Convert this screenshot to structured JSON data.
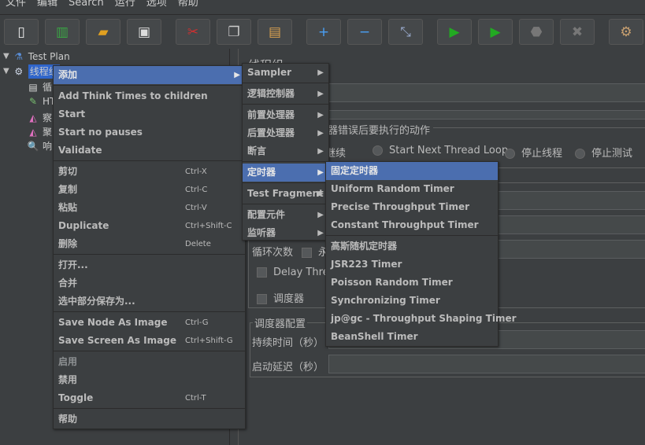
{
  "menubar": [
    "文件",
    "编辑",
    "Search",
    "运行",
    "选项",
    "帮助"
  ],
  "toolbar": [
    {
      "icon": "new-icon",
      "g": "▯",
      "c": "#eeeeee"
    },
    {
      "icon": "templates-icon",
      "g": "▥",
      "c": "#3aa844"
    },
    {
      "icon": "open-icon",
      "g": "▰",
      "c": "#e0a020"
    },
    {
      "icon": "save-icon",
      "g": "▣",
      "c": "#dddddd"
    },
    {
      "icon": "cut-icon",
      "g": "✂",
      "c": "#d03030"
    },
    {
      "icon": "copy-icon",
      "g": "❐",
      "c": "#cccccc"
    },
    {
      "icon": "paste-icon",
      "g": "▤",
      "c": "#d8a050"
    },
    {
      "icon": "expand-icon",
      "g": "+",
      "c": "#4a9ff5"
    },
    {
      "icon": "collapse-icon",
      "g": "−",
      "c": "#4a9ff5"
    },
    {
      "icon": "toggle-icon",
      "g": "⤡",
      "c": "#9ac"
    },
    {
      "icon": "start-icon",
      "g": "▶",
      "c": "#22aa22"
    },
    {
      "icon": "start-no-pauses-icon",
      "g": "▶",
      "c": "#22aa22"
    },
    {
      "icon": "stop-icon",
      "g": "⬣",
      "c": "#777"
    },
    {
      "icon": "shutdown-icon",
      "g": "✖",
      "c": "#777"
    },
    {
      "icon": "clear-icon",
      "g": "⚙",
      "c": "#c8a070"
    }
  ],
  "tree": {
    "items": [
      {
        "label": "Test Plan",
        "icon": "flask-icon",
        "g": "⚗",
        "c": "#5a8fd8"
      },
      {
        "label": "线程组",
        "icon": "gear-icon",
        "g": "⚙",
        "c": "#cfd8e8"
      },
      {
        "label": "循",
        "icon": "controller-icon",
        "g": "▤",
        "c": "#dddddd"
      },
      {
        "label": "HT",
        "icon": "pipette-icon",
        "g": "✎",
        "c": "#7ac070"
      },
      {
        "label": "察",
        "icon": "listener-icon",
        "g": "◭",
        "c": "#e070c0"
      },
      {
        "label": "聚",
        "icon": "listener-icon",
        "g": "◭",
        "c": "#e070c0"
      },
      {
        "label": "响",
        "icon": "magnifier-icon",
        "g": "🔍",
        "c": "#dddddd"
      }
    ]
  },
  "right": {
    "title": "线程组",
    "error_group": "在取样器错误后要执行的动作",
    "radios": [
      "继续",
      "Start Next Thread Loop",
      "停止线程",
      "停止测试"
    ],
    "loop_label": "循环次数",
    "forever": "永",
    "delay": "Delay Thread creation until needed",
    "scheduler": "调度器",
    "sched_group": "调度器配置",
    "duration": "持续时间（秒）",
    "startup": "启动延迟（秒）"
  },
  "context_menu": [
    {
      "t": "item",
      "label": "添加",
      "arrow": true,
      "sel": true
    },
    {
      "t": "sep"
    },
    {
      "t": "item",
      "label": "Add Think Times to children"
    },
    {
      "t": "item",
      "label": "Start"
    },
    {
      "t": "item",
      "label": "Start no pauses"
    },
    {
      "t": "item",
      "label": "Validate"
    },
    {
      "t": "sep"
    },
    {
      "t": "item",
      "label": "剪切",
      "sc": "Ctrl-X"
    },
    {
      "t": "item",
      "label": "复制",
      "sc": "Ctrl-C"
    },
    {
      "t": "item",
      "label": "粘贴",
      "sc": "Ctrl-V"
    },
    {
      "t": "item",
      "label": "Duplicate",
      "sc": "Ctrl+Shift-C"
    },
    {
      "t": "item",
      "label": "删除",
      "sc": "Delete"
    },
    {
      "t": "sep"
    },
    {
      "t": "item",
      "label": "打开..."
    },
    {
      "t": "item",
      "label": "合并"
    },
    {
      "t": "item",
      "label": "选中部分保存为..."
    },
    {
      "t": "sep"
    },
    {
      "t": "item",
      "label": "Save Node As Image",
      "sc": "Ctrl-G"
    },
    {
      "t": "item",
      "label": "Save Screen As Image",
      "sc": "Ctrl+Shift-G"
    },
    {
      "t": "sep"
    },
    {
      "t": "item",
      "label": "启用",
      "dis": true
    },
    {
      "t": "item",
      "label": "禁用"
    },
    {
      "t": "item",
      "label": "Toggle",
      "sc": "Ctrl-T"
    },
    {
      "t": "sep"
    },
    {
      "t": "item",
      "label": "帮助"
    }
  ],
  "add_menu": [
    {
      "t": "item",
      "label": "Sampler",
      "arrow": true
    },
    {
      "t": "sep"
    },
    {
      "t": "item",
      "label": "逻辑控制器",
      "arrow": true
    },
    {
      "t": "sep"
    },
    {
      "t": "item",
      "label": "前置处理器",
      "arrow": true
    },
    {
      "t": "item",
      "label": "后置处理器",
      "arrow": true
    },
    {
      "t": "item",
      "label": "断言",
      "arrow": true
    },
    {
      "t": "sep"
    },
    {
      "t": "item",
      "label": "定时器",
      "arrow": true,
      "sel": true
    },
    {
      "t": "sep"
    },
    {
      "t": "item",
      "label": "Test Fragment",
      "arrow": true
    },
    {
      "t": "sep"
    },
    {
      "t": "item",
      "label": "配置元件",
      "arrow": true
    },
    {
      "t": "item",
      "label": "监听器",
      "arrow": true
    }
  ],
  "timer_menu": [
    {
      "t": "item",
      "label": "固定定时器",
      "sel": true
    },
    {
      "t": "item",
      "label": "Uniform Random Timer"
    },
    {
      "t": "item",
      "label": "Precise Throughput Timer"
    },
    {
      "t": "item",
      "label": "Constant Throughput Timer"
    },
    {
      "t": "sep"
    },
    {
      "t": "item",
      "label": "高斯随机定时器"
    },
    {
      "t": "item",
      "label": "JSR223 Timer"
    },
    {
      "t": "item",
      "label": "Poisson Random Timer"
    },
    {
      "t": "item",
      "label": "Synchronizing Timer"
    },
    {
      "t": "item",
      "label": "jp@gc - Throughput Shaping Timer"
    },
    {
      "t": "item",
      "label": "BeanShell Timer"
    }
  ],
  "colors": {
    "selection": "#4b6eaf",
    "background": "#3c3f41",
    "text": "#bbbbbb"
  }
}
